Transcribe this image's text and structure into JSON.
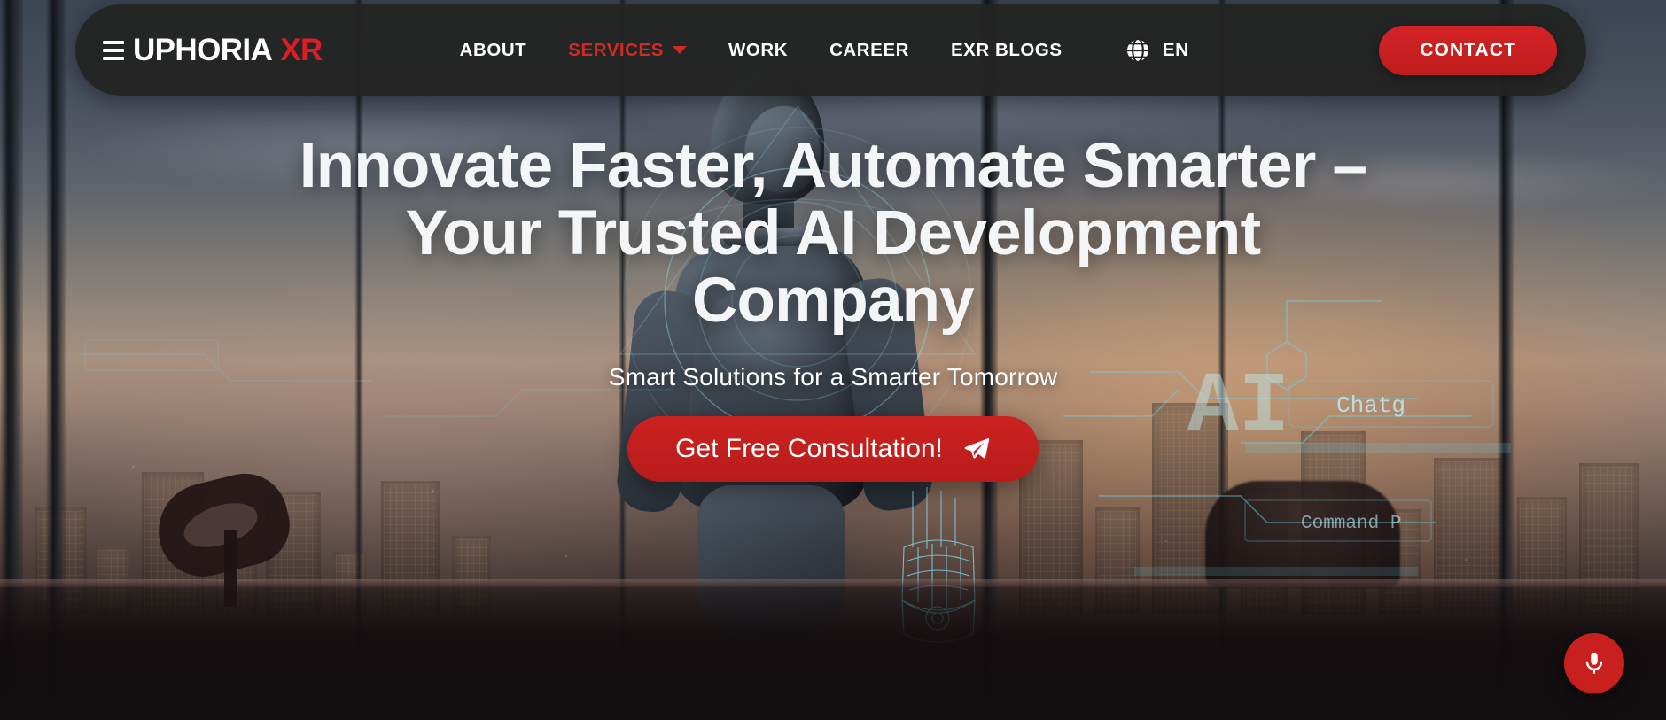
{
  "brand": {
    "logo_main": "UPHORIA",
    "logo_accent": "XR",
    "logo_mark_icon": "hamburger-bars-e-icon"
  },
  "nav": {
    "items": [
      {
        "label": "ABOUT",
        "active": false,
        "has_dropdown": false
      },
      {
        "label": "SERVICES",
        "active": true,
        "has_dropdown": true
      },
      {
        "label": "WORK",
        "active": false,
        "has_dropdown": false
      },
      {
        "label": "CAREER",
        "active": false,
        "has_dropdown": false
      },
      {
        "label": "EXR BLOGS",
        "active": false,
        "has_dropdown": false
      }
    ],
    "language": {
      "label": "EN",
      "icon": "globe-icon"
    },
    "contact_label": "CONTACT"
  },
  "hero": {
    "title": "Innovate Faster, Automate Smarter – Your Trusted AI Development Company",
    "subtitle": "Smart Solutions for a Smarter Tomorrow",
    "cta_label": "Get Free Consultation!",
    "cta_icon": "paper-plane-send-icon"
  },
  "background": {
    "hud_labels": [
      "AI",
      "Chatg",
      "Command P"
    ]
  },
  "floating_action": {
    "icon": "microphone-icon",
    "color": "#c8201e"
  },
  "colors": {
    "accent_red": "#d32a26",
    "button_red": "#c8201e",
    "nav_background": "#232323",
    "text_light": "#ffffff"
  }
}
